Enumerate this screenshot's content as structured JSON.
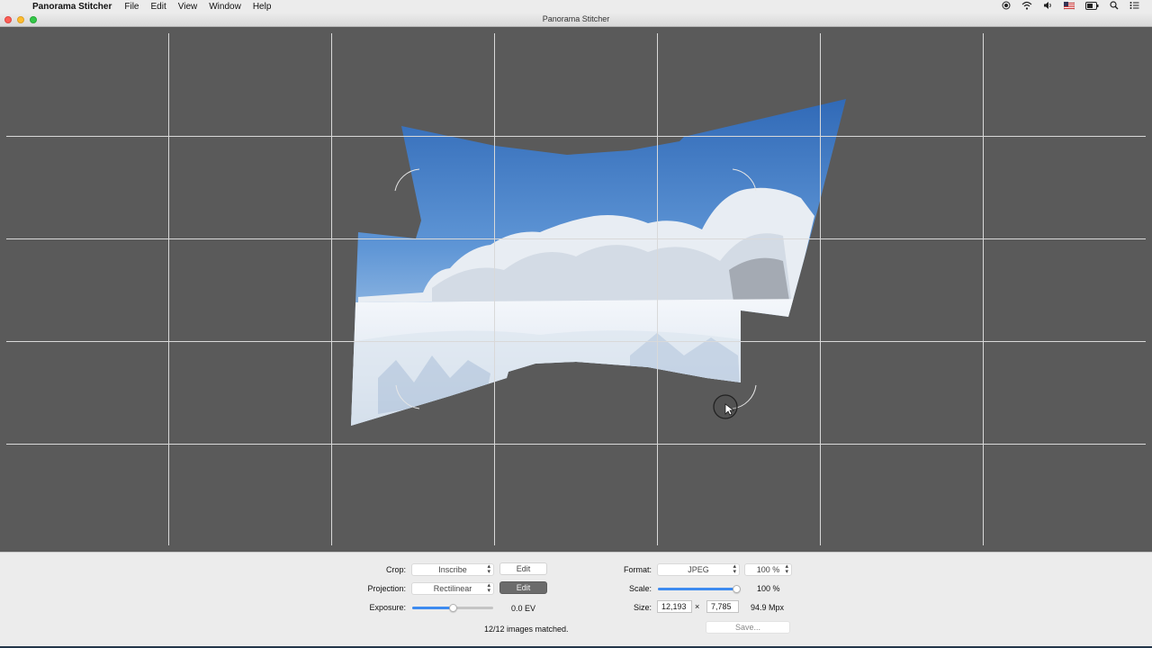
{
  "menubar": {
    "apple_glyph": "",
    "app_name": "Panorama Stitcher",
    "items": [
      "File",
      "Edit",
      "View",
      "Window",
      "Help"
    ],
    "status_icons": [
      "record-icon",
      "wifi-icon",
      "volume-icon",
      "us-flag-icon",
      "battery-icon",
      "spotlight-search-icon",
      "notification-center-icon"
    ]
  },
  "window": {
    "title": "Panorama Stitcher"
  },
  "canvas": {
    "background": "#5a5a5a",
    "grid_color": "#d8d8d8"
  },
  "controls": {
    "crop": {
      "label": "Crop:",
      "value": "Inscribe",
      "edit_label": "Edit"
    },
    "projection": {
      "label": "Projection:",
      "value": "Rectilinear",
      "edit_label": "Edit"
    },
    "exposure": {
      "label": "Exposure:",
      "value": "0.0 EV",
      "slider_fraction": 0.5
    },
    "status": "12/12 images matched.",
    "format": {
      "label": "Format:",
      "value": "JPEG",
      "quality": "100 %"
    },
    "scale": {
      "label": "Scale:",
      "value": "100 %",
      "slider_fraction": 1.0
    },
    "size": {
      "label": "Size:",
      "width": "12,193",
      "separator": "×",
      "height": "7,785",
      "megapixels": "94.9 Mpx"
    },
    "save_label": "Save..."
  }
}
